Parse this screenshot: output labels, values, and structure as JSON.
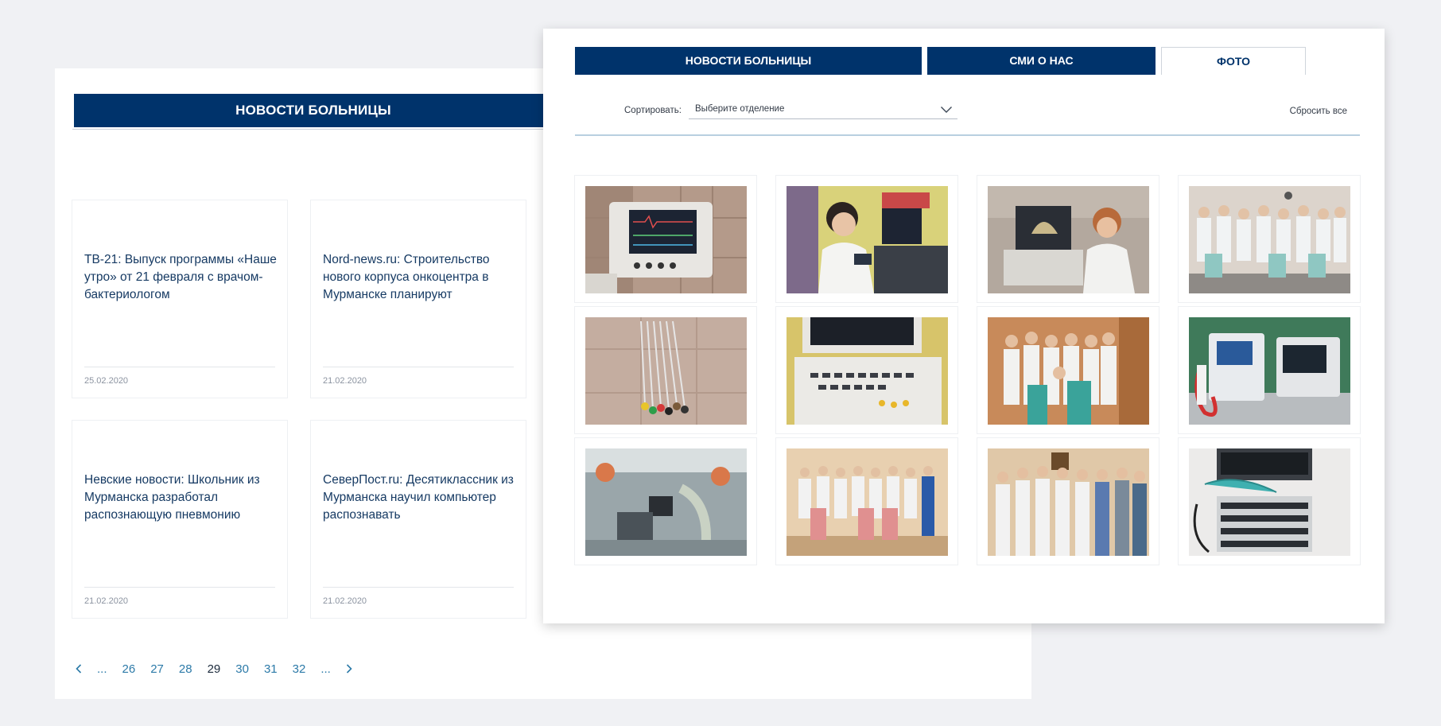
{
  "news": {
    "header": "НОВОСТИ БОЛЬНИЦЫ",
    "cards": [
      {
        "title": "ТВ-21: Выпуск программы «Наше утро» от 21 февраля с врачом-бактериологом",
        "date": "25.02.2020"
      },
      {
        "title": "Nord-news.ru: Строительство нового корпуса онкоцентра в Мурманске планируют",
        "date": "21.02.2020"
      },
      {
        "title": "Невские новости: Школьник из Мурманска разработал распознающую пневмонию",
        "date": "21.02.2020"
      },
      {
        "title": "СеверПост.ru: Десятиклассник из Мурманска научил компьютер распознавать",
        "date": "21.02.2020"
      }
    ],
    "pagination": {
      "prev": "prev-arrow",
      "items": [
        "...",
        "26",
        "27",
        "28",
        "29",
        "30",
        "31",
        "32",
        "..."
      ],
      "active": "29",
      "next": "next-arrow"
    }
  },
  "photos": {
    "tabs": [
      {
        "label": "НОВОСТИ БОЛЬНИЦЫ"
      },
      {
        "label": "СМИ О НАС"
      },
      {
        "label": "ФОТО"
      }
    ],
    "active_tab": "ФОТО",
    "sort": {
      "label": "Сортировать:",
      "placeholder": "Выберите отделение",
      "reset": "Сбросить все"
    },
    "items": [
      "patient-monitor",
      "doctor-at-monitor",
      "doctor-ultrasound",
      "staff-group",
      "ecg-cables",
      "ultrasound-keyboard",
      "staff-group",
      "defibrillator",
      "operating-room",
      "staff-group",
      "staff-group",
      "endoscopy-rack"
    ]
  },
  "colors": {
    "navy": "#00336b",
    "link": "#2c7aa8",
    "background": "#f0f1f4"
  }
}
